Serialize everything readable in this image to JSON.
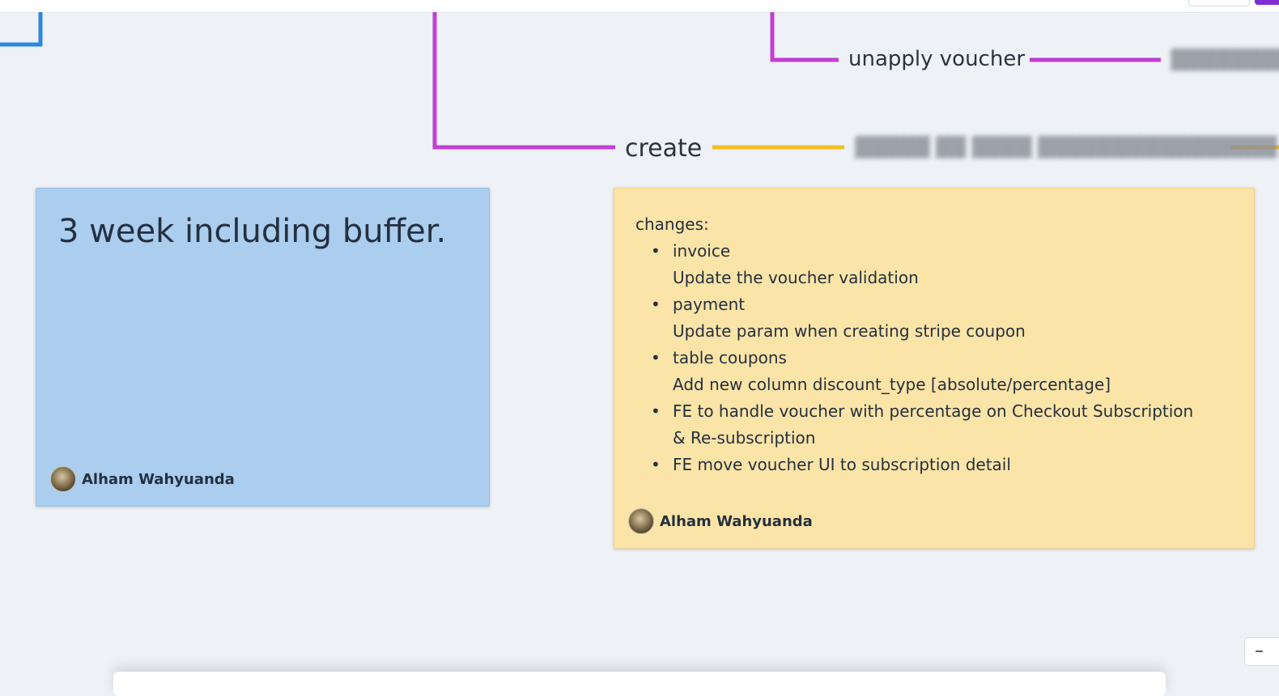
{
  "canvas": {
    "nodes": {
      "unapply_voucher": "unapply voucher",
      "create": "create"
    },
    "colors": {
      "blue_connector": "#2e86de",
      "purple_connector": "#c13ed6",
      "yellow_connector": "#f5bd26",
      "purple_accent": "#7b2fd0"
    }
  },
  "sticky_blue": {
    "text": "3 week including buffer.",
    "author": "Alham Wahyuanda",
    "color": "#abcdee"
  },
  "sticky_yellow": {
    "heading": "changes:",
    "items": [
      {
        "title": "invoice",
        "detail": "Update the voucher validation"
      },
      {
        "title": "payment",
        "detail": "Update param when creating stripe coupon"
      },
      {
        "title": "table coupons",
        "detail": "Add new column discount_type [absolute/percentage]"
      },
      {
        "title": "FE to handle voucher with percentage on Checkout Subscription",
        "detail": "& Re-subscription"
      },
      {
        "title": "FE move voucher UI to subscription detail",
        "detail": ""
      }
    ],
    "author": "Alham Wahyuanda",
    "color": "#fbe4a8"
  },
  "zoom": {
    "out_label": "–"
  }
}
